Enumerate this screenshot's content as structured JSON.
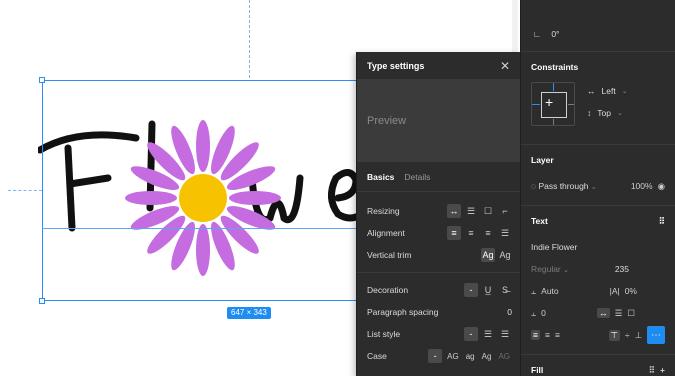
{
  "canvas": {
    "dimension_badge": "647 × 343",
    "text_layer_content": "Flowe"
  },
  "type_settings": {
    "title": "Type settings",
    "close_icon": "close-icon",
    "preview_label": "Preview",
    "tabs": [
      {
        "label": "Basics",
        "active": true
      },
      {
        "label": "Details",
        "active": false
      }
    ],
    "rows": {
      "resizing": "Resizing",
      "alignment": "Alignment",
      "vertical_trim": "Vertical trim",
      "decoration": "Decoration",
      "paragraph_spacing": "Paragraph spacing",
      "paragraph_spacing_value": "0",
      "list_style": "List style",
      "case": "Case"
    },
    "case_options": [
      "AG",
      "ag",
      "Ag",
      "AG"
    ]
  },
  "properties": {
    "rotation_value": "0°",
    "constraints": {
      "title": "Constraints",
      "horizontal": "Left",
      "vertical": "Top"
    },
    "layer": {
      "title": "Layer",
      "blend_mode": "Pass through",
      "opacity": "100%"
    },
    "text": {
      "title": "Text",
      "font_family": "Indie Flower",
      "font_weight": "Regular",
      "font_size": "235",
      "line_height": "Auto",
      "letter_spacing": "0%",
      "paragraph_spacing": "0"
    },
    "fill": {
      "title": "Fill"
    }
  },
  "colors": {
    "accent": "#1d8df2",
    "panel_bg": "#2c2c2c",
    "petal": "#c56ce0",
    "flower_center": "#f7c200"
  }
}
